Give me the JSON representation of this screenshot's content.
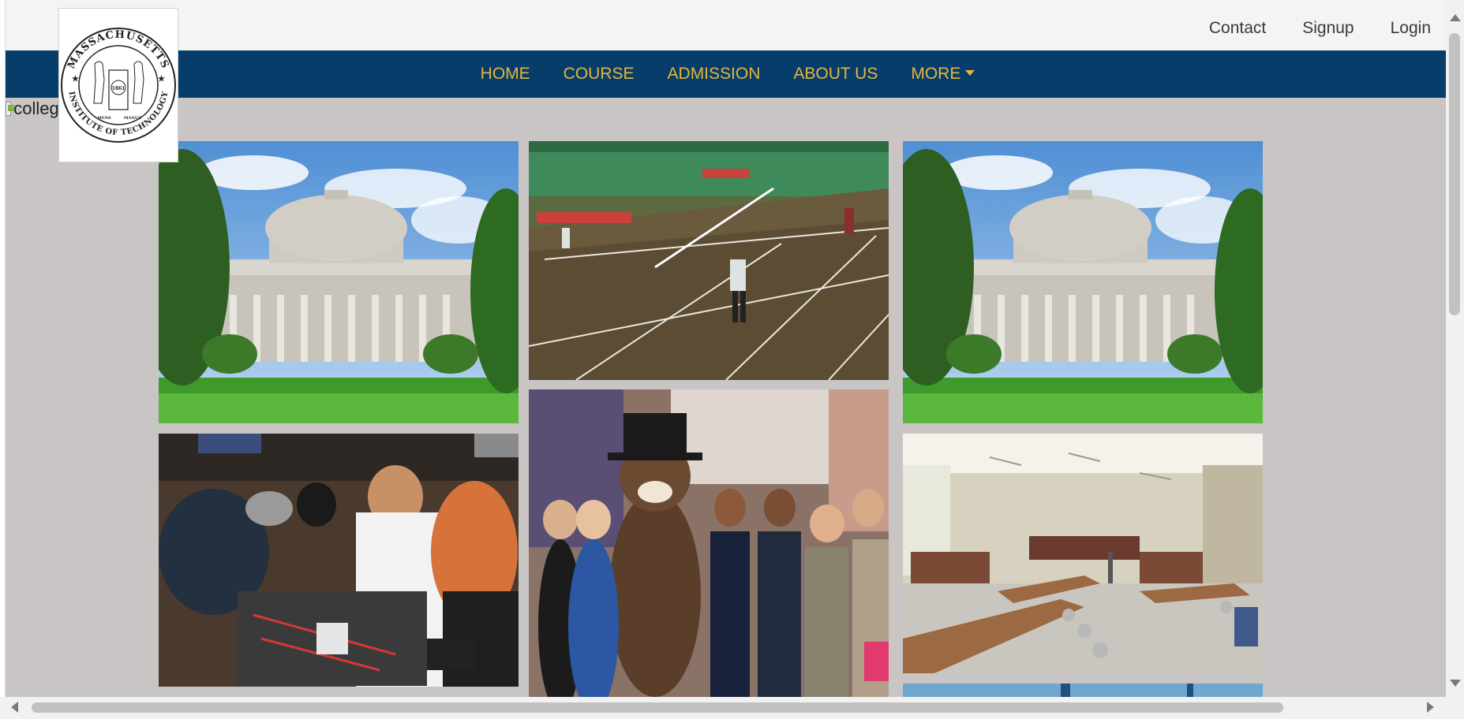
{
  "top_links": {
    "contact": "Contact",
    "signup": "Signup",
    "login": "Login"
  },
  "nav": {
    "home": "HOME",
    "course": "COURSE",
    "admission": "ADMISSION",
    "about": "ABOUT US",
    "more": "MORE"
  },
  "broken_image_alt": "college",
  "seal": {
    "top_text": "MASSACHUSETTS",
    "bottom_text": "INSTITUTE OF TECHNOLOGY",
    "year": "1861",
    "motto_left": "MENS",
    "motto_right": "MANUS"
  },
  "colors": {
    "navbar": "#063d6b",
    "nav_text": "#e8b53a",
    "page_bg": "#c9c5c5"
  },
  "gallery": [
    {
      "subject": "great-dome-building"
    },
    {
      "subject": "badminton-court"
    },
    {
      "subject": "great-dome-building"
    },
    {
      "subject": "robotics-students"
    },
    {
      "subject": "beaver-mascot-group"
    },
    {
      "subject": "library-reading-hall"
    }
  ]
}
